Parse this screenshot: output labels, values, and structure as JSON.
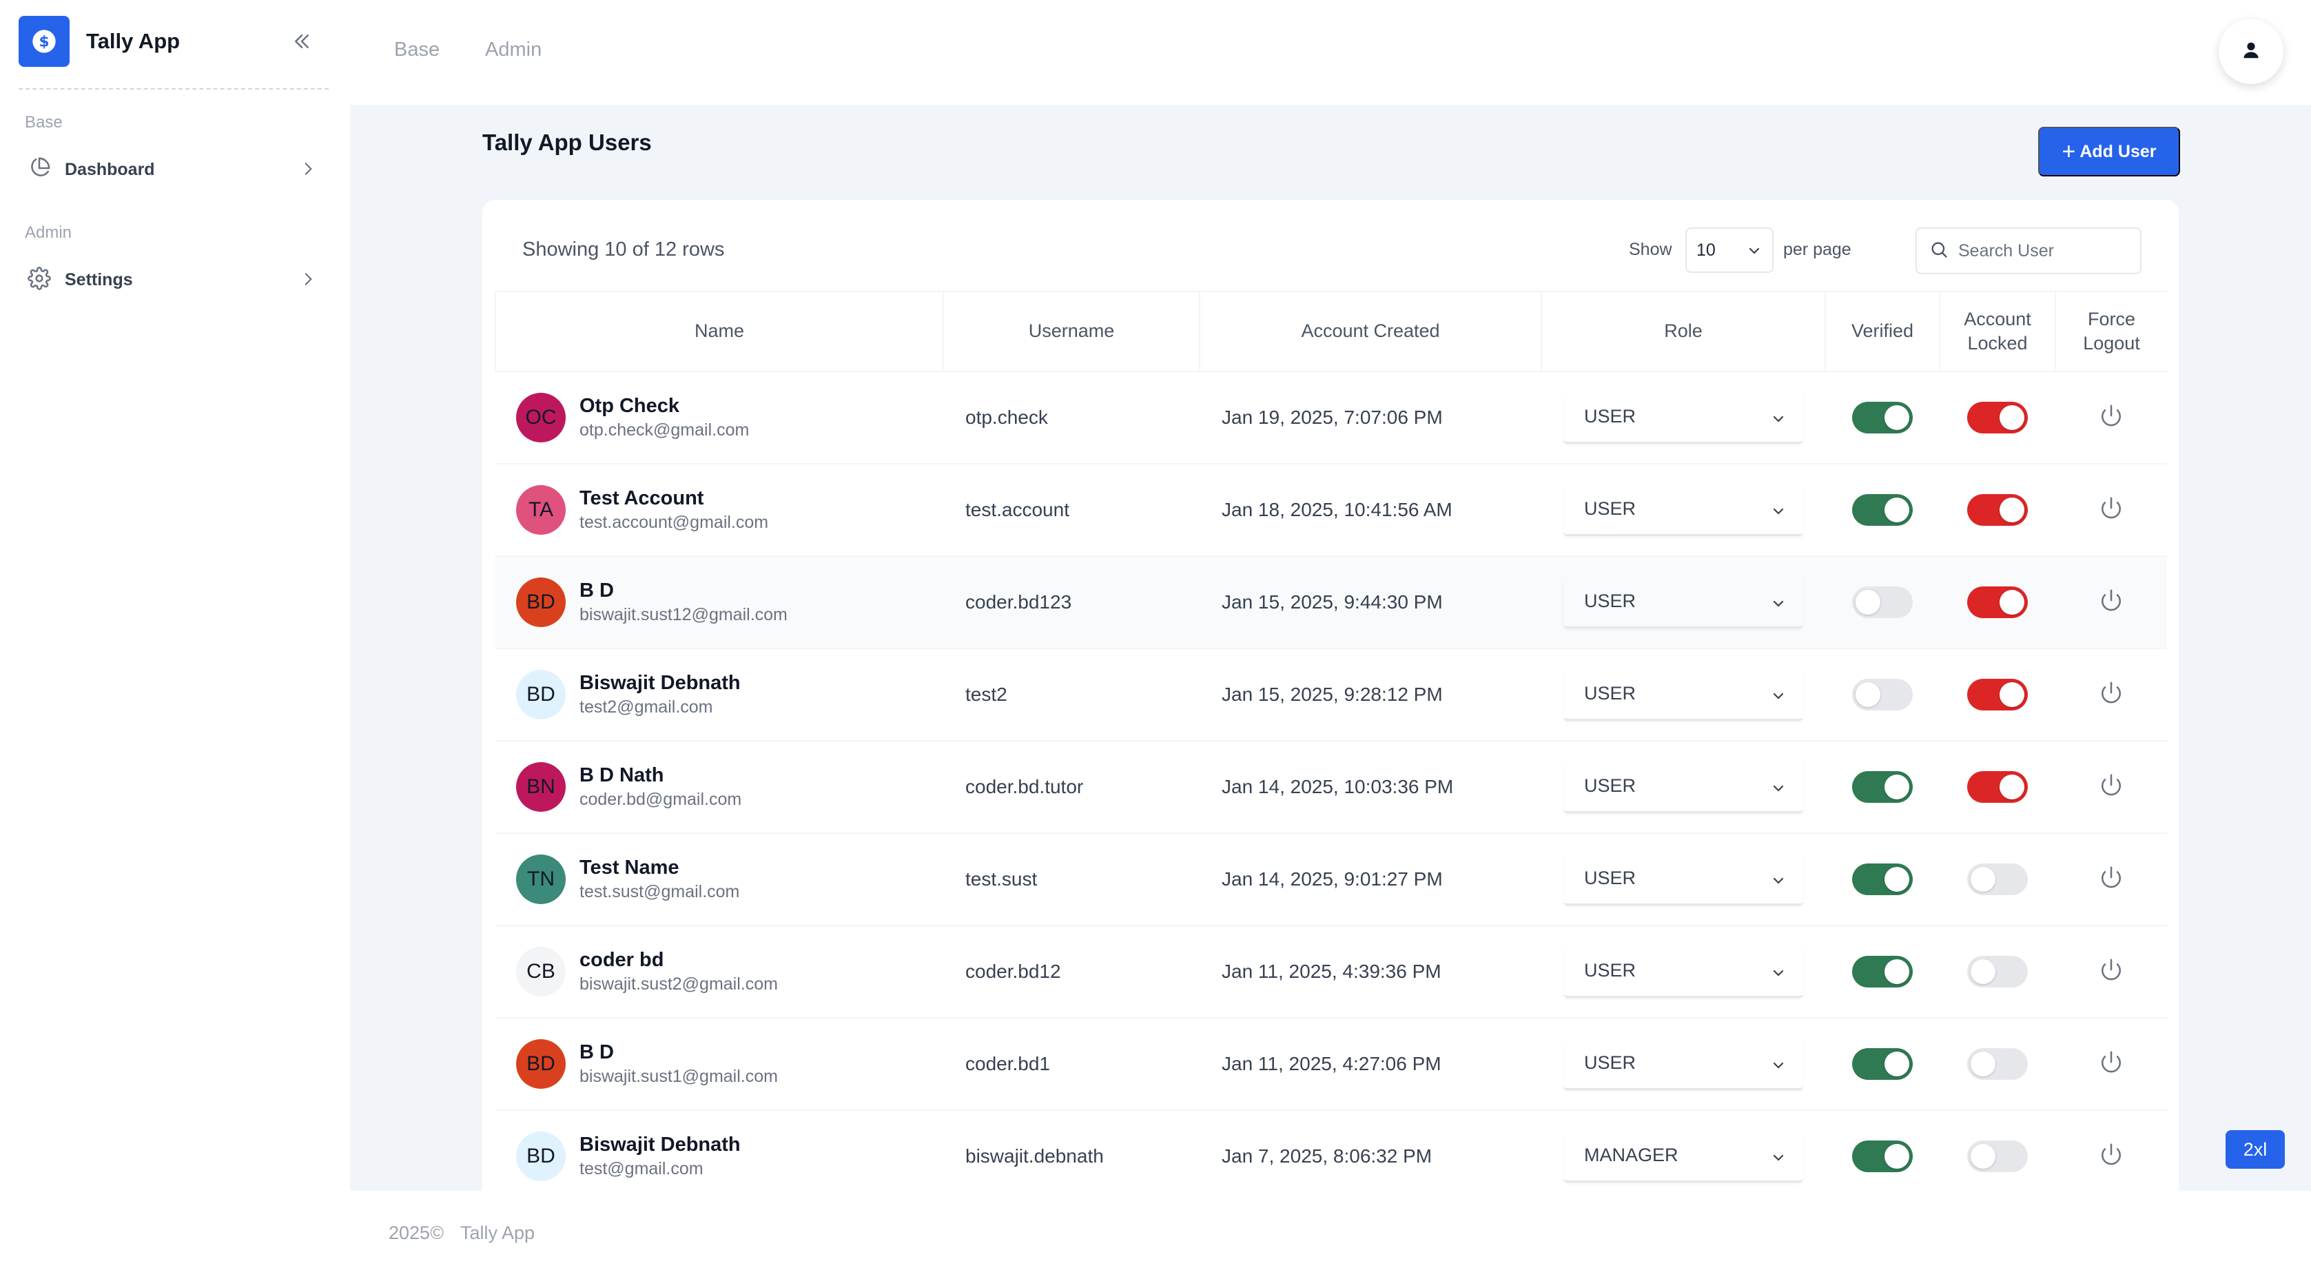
{
  "app": {
    "name": "Tally App"
  },
  "sidebar": {
    "sections": [
      {
        "title": "Base",
        "items": [
          {
            "label": "Dashboard",
            "icon": "pie-chart-icon"
          }
        ]
      },
      {
        "title": "Admin",
        "items": [
          {
            "label": "Settings",
            "icon": "gear-icon"
          }
        ]
      }
    ]
  },
  "topnav": {
    "links": [
      "Base",
      "Admin"
    ]
  },
  "page": {
    "title": "Tally App Users",
    "add_button": "Add User"
  },
  "table_controls": {
    "showing": "Showing 10 of 12 rows",
    "show_label": "Show",
    "per_page_value": "10",
    "per_page_label": "per page",
    "search_placeholder": "Search User"
  },
  "columns": [
    "Name",
    "Username",
    "Account Created",
    "Role",
    "Verified",
    "Account Locked",
    "Force Logout"
  ],
  "columns_display": [
    "Name",
    "Username",
    "Account Created",
    "Role",
    "Verified",
    "Account\nLocked",
    "Force\nLogout"
  ],
  "users": [
    {
      "initials": "OC",
      "name": "Otp Check",
      "email": "otp.check@gmail.com",
      "username": "otp.check",
      "created": "Jan 19, 2025, 7:07:06 PM",
      "role": "USER",
      "verified": true,
      "locked": true,
      "avatar_color": "#be185d"
    },
    {
      "initials": "TA",
      "name": "Test Account",
      "email": "test.account@gmail.com",
      "username": "test.account",
      "created": "Jan 18, 2025, 10:41:56 AM",
      "role": "USER",
      "verified": true,
      "locked": true,
      "avatar_color": "#e0527e"
    },
    {
      "initials": "BD",
      "name": "B D",
      "email": "biswajit.sust12@gmail.com",
      "username": "coder.bd123",
      "created": "Jan 15, 2025, 9:44:30 PM",
      "role": "USER",
      "verified": false,
      "locked": true,
      "avatar_color": "#d9411e"
    },
    {
      "initials": "BD",
      "name": "Biswajit Debnath",
      "email": "test2@gmail.com",
      "username": "test2",
      "created": "Jan 15, 2025, 9:28:12 PM",
      "role": "USER",
      "verified": false,
      "locked": true,
      "avatar_color": "#e0f2fe"
    },
    {
      "initials": "BN",
      "name": "B D Nath",
      "email": "coder.bd@gmail.com",
      "username": "coder.bd.tutor",
      "created": "Jan 14, 2025, 10:03:36 PM",
      "role": "USER",
      "verified": true,
      "locked": true,
      "avatar_color": "#be185d"
    },
    {
      "initials": "TN",
      "name": "Test Name",
      "email": "test.sust@gmail.com",
      "username": "test.sust",
      "created": "Jan 14, 2025, 9:01:27 PM",
      "role": "USER",
      "verified": true,
      "locked": false,
      "avatar_color": "#3b8a7a"
    },
    {
      "initials": "CB",
      "name": "coder bd",
      "email": "biswajit.sust2@gmail.com",
      "username": "coder.bd12",
      "created": "Jan 11, 2025, 4:39:36 PM",
      "role": "USER",
      "verified": true,
      "locked": false,
      "avatar_color": "#f3f4f6"
    },
    {
      "initials": "BD",
      "name": "B D",
      "email": "biswajit.sust1@gmail.com",
      "username": "coder.bd1",
      "created": "Jan 11, 2025, 4:27:06 PM",
      "role": "USER",
      "verified": true,
      "locked": false,
      "avatar_color": "#d9411e"
    },
    {
      "initials": "BD",
      "name": "Biswajit Debnath",
      "email": "test@gmail.com",
      "username": "biswajit.debnath",
      "created": "Jan 7, 2025, 8:06:32 PM",
      "role": "MANAGER",
      "verified": true,
      "locked": false,
      "avatar_color": "#e0f2fe"
    }
  ],
  "highlighted_row": 2,
  "colors": {
    "primary": "#2563eb",
    "verified_on": "#2f7a52",
    "locked_on": "#dc2626",
    "toggle_off": "#e5e7eb"
  },
  "breakpoint_badge": "2xl",
  "footer": {
    "year": "2025©",
    "app": "Tally App"
  }
}
